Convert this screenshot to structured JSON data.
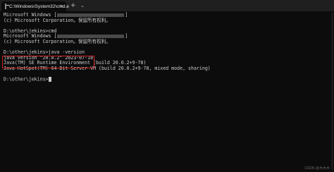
{
  "window": {
    "tab_title": "C:\\Windows\\System32\\cmd.e",
    "close_glyph": "×",
    "new_tab_glyph": "+",
    "dropdown_glyph": "⌄"
  },
  "console": {
    "lines": [
      "Microsoft Windows [",
      "(c) Microsoft Corporation。保留所有权利。",
      "",
      "D:\\other\\jekins>cmd",
      "Microsoft Windows [",
      "(c) Microsoft Corporation。保留所有权利。",
      "",
      "D:\\other\\jekins>java -version",
      "java version \"20.0.2\" 2023-07-18",
      "Java(TM) SE Runtime Environment (build 20.0.2+9-78)",
      "Java HotSpot(TM) 64-Bit Server VM (build 20.0.2+9-78, mixed mode, sharing)",
      "",
      "D:\\other\\jekins>"
    ],
    "version_close": "]"
  },
  "watermark": "CSDN @木木木"
}
